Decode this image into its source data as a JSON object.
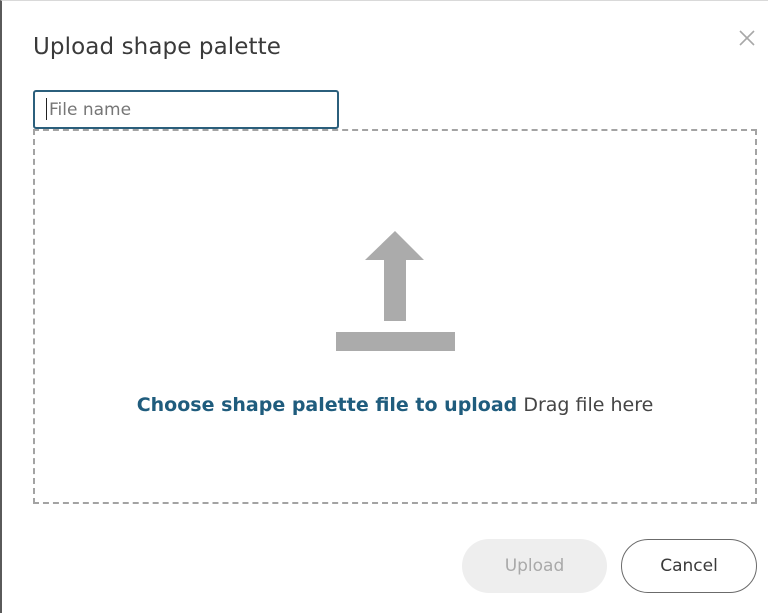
{
  "dialog": {
    "title": "Upload shape palette",
    "close_icon": "close-icon"
  },
  "filename": {
    "value": "",
    "placeholder": "File name"
  },
  "dropzone": {
    "icon": "upload-arrow-icon",
    "choose_link": "Choose shape palette file to upload",
    "drag_hint": "Drag file here"
  },
  "footer": {
    "upload_label": "Upload",
    "cancel_label": "Cancel"
  },
  "colors": {
    "link": "#1f5c7d",
    "input_border": "#2b5f7c",
    "icon_gray": "#ababab",
    "disabled_button_bg": "#eeeeee",
    "disabled_button_text": "#a9a9a9"
  }
}
